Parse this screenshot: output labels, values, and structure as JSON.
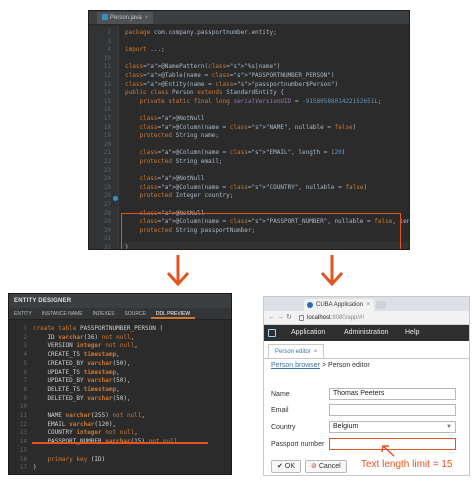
{
  "colors": {
    "accent": "#e3541f",
    "ide_bg": "#2b2b2b",
    "keyword": "#cc7832",
    "string": "#6a8759",
    "annotation": "#bbb529",
    "number": "#6897bb",
    "field": "#9876aa",
    "link": "#3a76b0",
    "appbar": "#2f2f2f"
  },
  "ide": {
    "tab_label": "Person.java",
    "tab_icon": "java-class-icon",
    "lines": [
      {
        "n": "2",
        "code": "package com.company.passportnumber.entity;"
      },
      {
        "n": "3",
        "code": ""
      },
      {
        "n": "4",
        "code": "import ...;"
      },
      {
        "n": "10",
        "code": ""
      },
      {
        "n": "11",
        "code": "@NamePattern(\"%s|name\")"
      },
      {
        "n": "12",
        "code": "@Table(name = \"PASSPORTNUMBER_PERSON\")"
      },
      {
        "n": "13",
        "code": "@Entity(name = \"passportnumber$Person\")"
      },
      {
        "n": "14",
        "code": "public class Person extends StandardEntity {"
      },
      {
        "n": "15",
        "code": "    private static final long serialVersionUID = -9158058801422152651L;"
      },
      {
        "n": "16",
        "code": ""
      },
      {
        "n": "17",
        "code": "    @NotNull"
      },
      {
        "n": "18",
        "code": "    @Column(name = \"NAME\", nullable = false)"
      },
      {
        "n": "19",
        "code": "    protected String name;"
      },
      {
        "n": "20",
        "code": ""
      },
      {
        "n": "21",
        "code": "    @Column(name = \"EMAIL\", length = 120)"
      },
      {
        "n": "22",
        "code": "    protected String email;"
      },
      {
        "n": "23",
        "code": ""
      },
      {
        "n": "24",
        "code": "    @NotNull"
      },
      {
        "n": "25",
        "code": "    @Column(name = \"COUNTRY\", nullable = false)"
      },
      {
        "n": "26",
        "code": "    protected Integer country;"
      },
      {
        "n": "27",
        "code": ""
      },
      {
        "n": "28",
        "code": "    @NotNull"
      },
      {
        "n": "29",
        "code": "    @Column(name = \"PASSPORT_NUMBER\", nullable = false, length = 15)"
      },
      {
        "n": "30",
        "code": "    protected String passportNumber;"
      },
      {
        "n": "31",
        "code": ""
      },
      {
        "n": "32",
        "code": "}"
      }
    ]
  },
  "designer": {
    "title": "ENTITY DESIGNER",
    "tabs": [
      "ENTITY",
      "INSTANCE NAME",
      "INDEXES",
      "SOURCE",
      "DDL PREVIEW"
    ],
    "active_tab": "DDL PREVIEW",
    "lines": [
      {
        "n": "1",
        "code": "create table PASSPORTNUMBER_PERSON ("
      },
      {
        "n": "2",
        "code": "    ID varchar(36) not null,"
      },
      {
        "n": "3",
        "code": "    VERSION integer not null,"
      },
      {
        "n": "4",
        "code": "    CREATE_TS timestamp,"
      },
      {
        "n": "5",
        "code": "    CREATED_BY varchar(50),"
      },
      {
        "n": "6",
        "code": "    UPDATE_TS timestamp,"
      },
      {
        "n": "7",
        "code": "    UPDATED_BY varchar(50),"
      },
      {
        "n": "8",
        "code": "    DELETE_TS timestamp,"
      },
      {
        "n": "9",
        "code": "    DELETED_BY varchar(50),"
      },
      {
        "n": "10",
        "code": "    "
      },
      {
        "n": "11",
        "code": "    NAME varchar(255) not null,"
      },
      {
        "n": "12",
        "code": "    EMAIL varchar(120),"
      },
      {
        "n": "13",
        "code": "    COUNTRY integer not null,"
      },
      {
        "n": "14",
        "code": "    PASSPORT_NUMBER varchar(15) not null,"
      },
      {
        "n": "15",
        "code": "    "
      },
      {
        "n": "16",
        "code": "    primary key (ID)"
      },
      {
        "n": "17",
        "code": ")"
      }
    ]
  },
  "browser": {
    "tab_title": "CUBA Application",
    "url_host": "localhost",
    "url_rest": ":8080/app/#!",
    "menu": [
      "Application",
      "Administration",
      "Help"
    ],
    "editor_tab": "Person editor",
    "breadcrumb_link": "Person browser",
    "breadcrumb_sep": ">",
    "breadcrumb_current": "Person editor",
    "form": {
      "name_label": "Name",
      "name_value": "Thomas Peeters",
      "email_label": "Email",
      "email_value": "",
      "country_label": "Country",
      "country_value": "Belgium",
      "passport_label": "Passport number",
      "passport_value": ""
    },
    "ok_label": "OK",
    "cancel_label": "Cancel"
  },
  "annotation": {
    "text": "Text length limit = 15"
  }
}
